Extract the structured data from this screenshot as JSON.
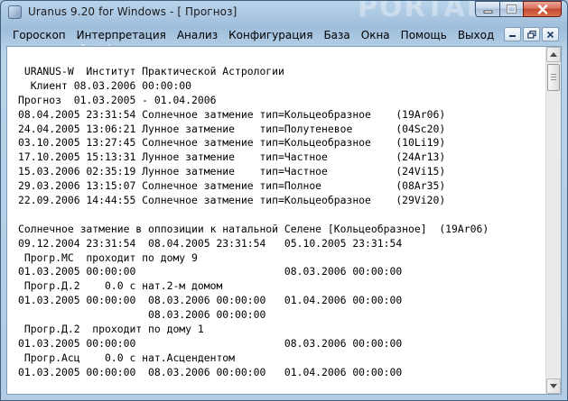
{
  "window": {
    "title": "Uranus 9.20 for Windows - [ Прогноз]",
    "watermark": "PORTAL",
    "watermark_url": "www.softportal.com"
  },
  "menu": {
    "items": [
      "Гороскоп",
      "Интерпретация",
      "Анализ",
      "Конфигурация",
      "База",
      "Окна",
      "Помощь",
      "Выход"
    ]
  },
  "colors": {
    "title_bar": "#a9c4de",
    "close_button": "#c44a30",
    "client_background": "#ffffff",
    "text": "#000000"
  },
  "document": {
    "lines": [
      " URANUS-W  Институт Практической Астрологии",
      "  Клиент 08.03.2006 00:00:00",
      "Прогноз  01.03.2005 - 01.04.2006",
      "08.04.2005 23:31:54 Солнечное затмение тип=Кольцеобразное    (19Ar06)",
      "24.04.2005 13:06:21 Лунное затмение    тип=Полутеневое       (04Sc20)",
      "03.10.2005 13:27:45 Солнечное затмение тип=Кольцеобразное    (10Li19)",
      "17.10.2005 15:13:31 Лунное затмение    тип=Частное           (24Ar13)",
      "15.03.2006 02:35:19 Лунное затмение    тип=Частное           (24Vi15)",
      "29.03.2006 13:15:07 Солнечное затмение тип=Полное            (08Ar35)",
      "22.09.2006 14:44:55 Солнечное затмение тип=Кольцеобразное    (29Vi20)",
      "",
      "Солнечное затмение в оппозиции к натальной Селене [Кольцеобразное]  (19Ar06)",
      "09.12.2004 23:31:54  08.04.2005 23:31:54   05.10.2005 23:31:54",
      " Прогр.MC  проходит по дому 9",
      "01.03.2005 00:00:00                        08.03.2006 00:00:00",
      " Прогр.Д.2    0.0 с нат.2-м домом",
      "01.03.2005 00:00:00  08.03.2006 00:00:00   01.04.2006 00:00:00",
      "                     08.03.2006 00:00:00",
      " Прогр.Д.2  проходит по дому 1",
      "01.03.2005 00:00:00                        08.03.2006 00:00:00",
      " Прогр.Асц    0.0 с нат.Асцендентом",
      "01.03.2005 00:00:00  08.03.2006 00:00:00   01.04.2006 00:00:00"
    ]
  },
  "scrollbar": {
    "position": 0
  }
}
